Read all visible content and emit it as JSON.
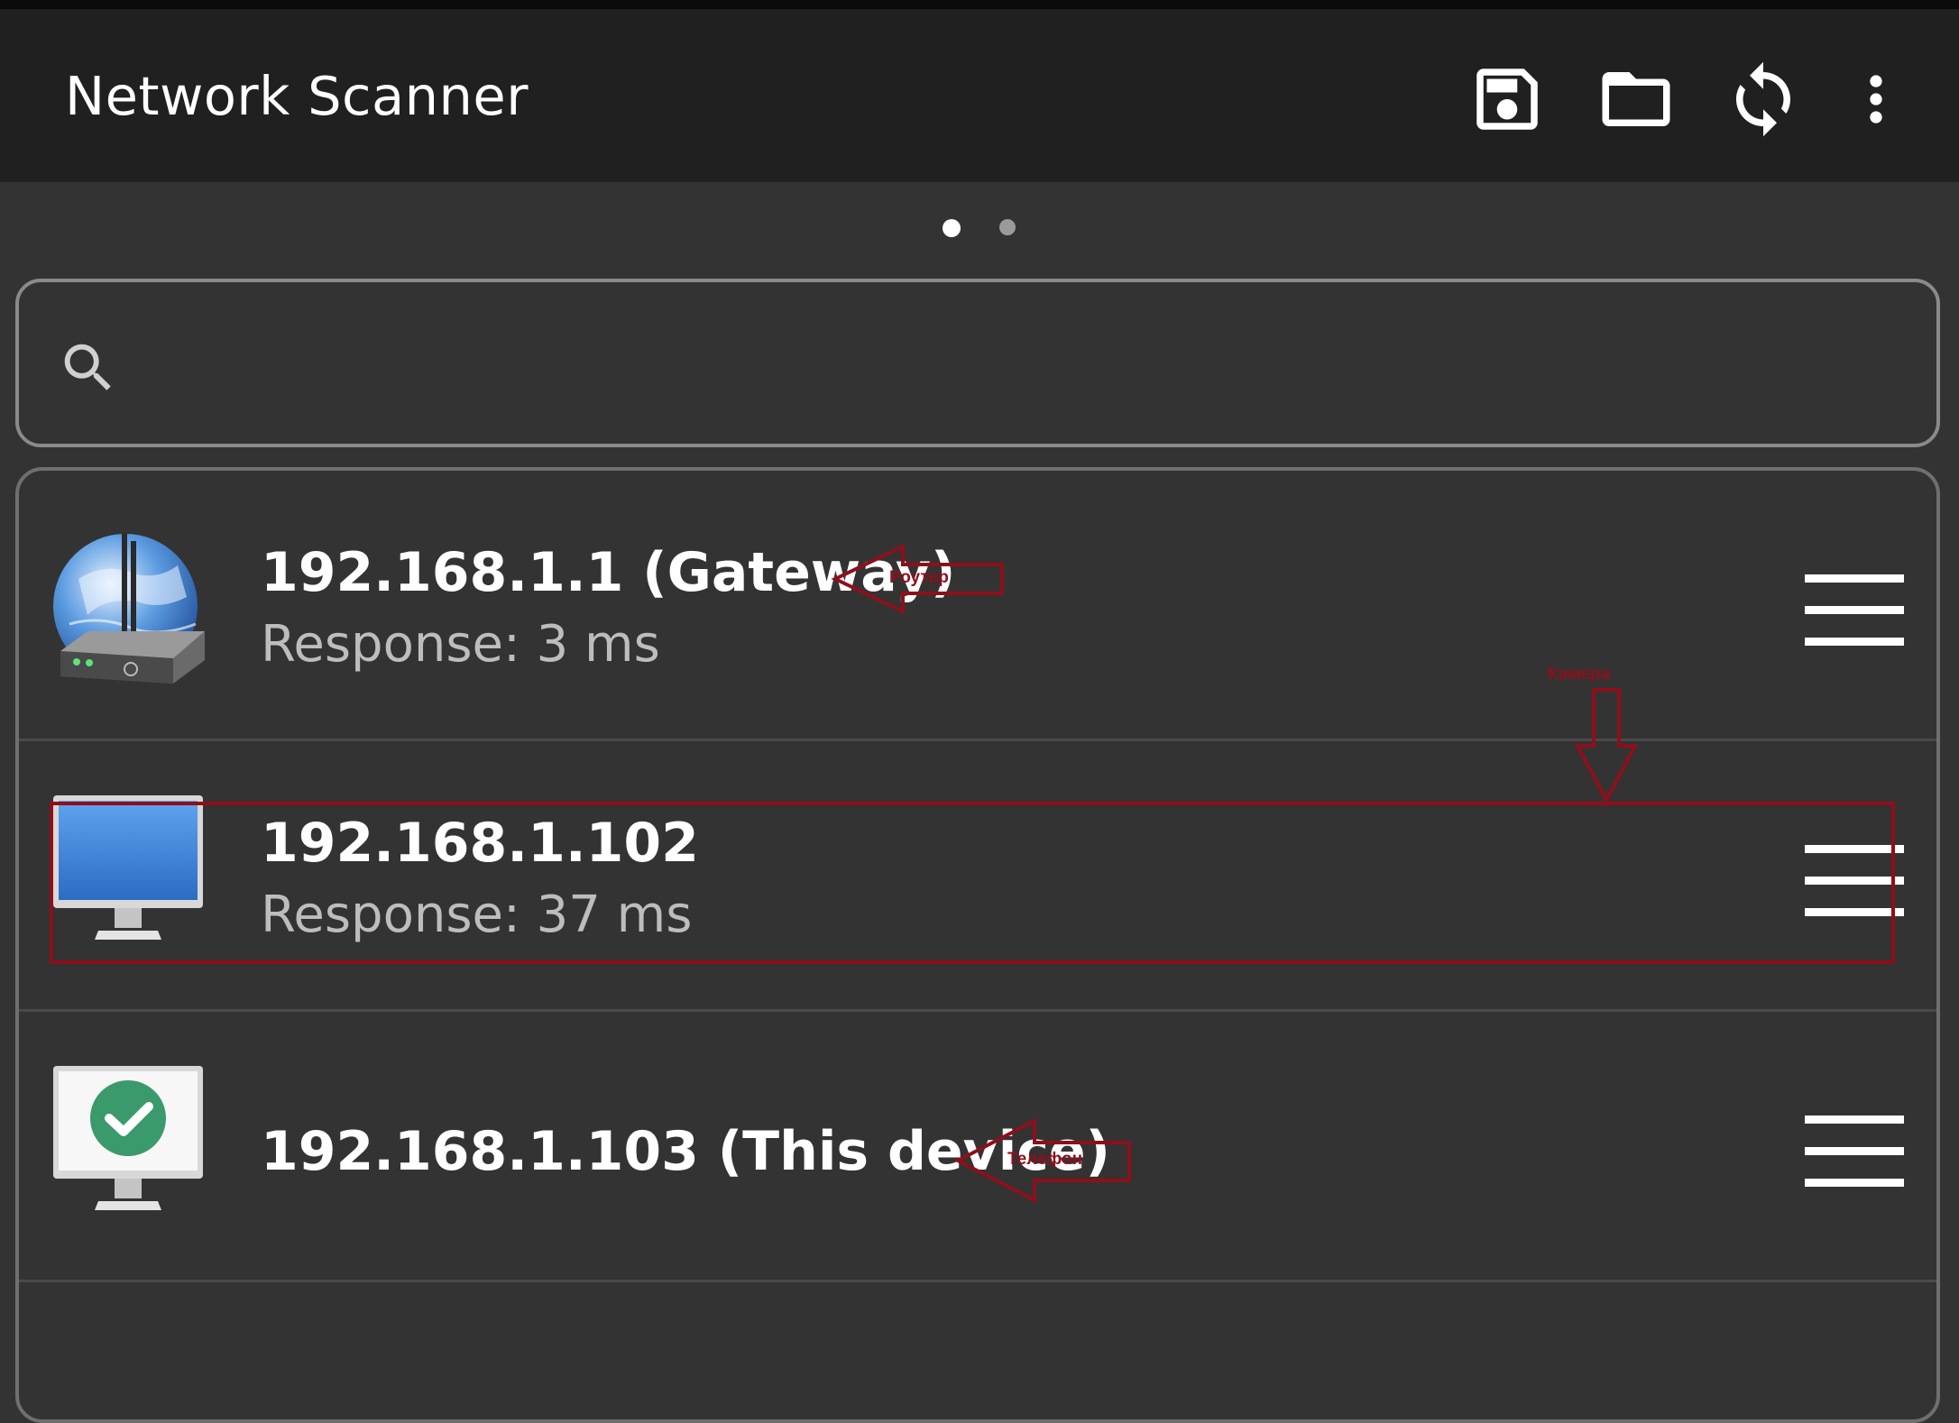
{
  "app": {
    "title": "Network Scanner",
    "actions": [
      "save-icon",
      "folder-icon",
      "refresh-icon",
      "more-vert-icon"
    ]
  },
  "pager": {
    "pages": 2,
    "active": 1
  },
  "search": {
    "placeholder": "",
    "value": ""
  },
  "devices": [
    {
      "ip": "192.168.1.1 (Gateway)",
      "response": "Response: 3 ms",
      "icon": "router-icon",
      "annotation": "Роутер"
    },
    {
      "ip": "192.168.1.102",
      "response": "Response: 37 ms",
      "icon": "monitor-icon",
      "annotation": "Камера"
    },
    {
      "ip": "192.168.1.103 (This device)",
      "response": "",
      "icon": "monitor-check-icon",
      "annotation": "Телефон"
    }
  ],
  "colors": {
    "appbar": "#202020",
    "background": "#333333",
    "annotation": "#8e0f1b",
    "check": "#3a9a6b",
    "screen_blue": "#3f86d8"
  }
}
